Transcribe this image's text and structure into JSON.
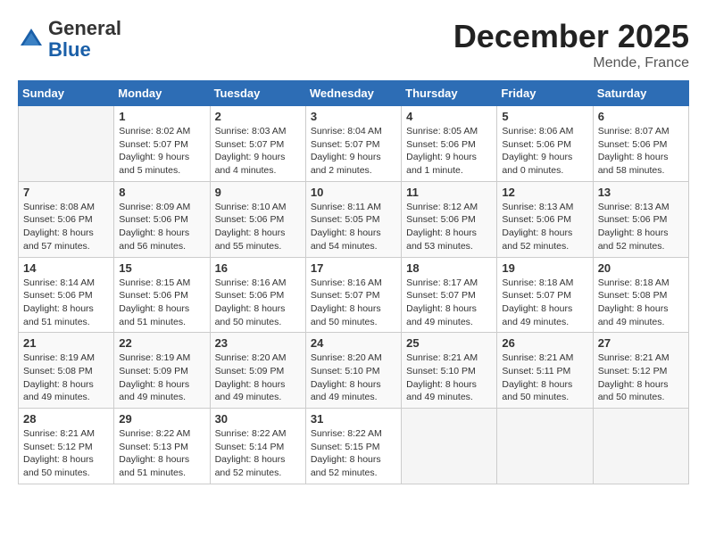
{
  "header": {
    "logo_general": "General",
    "logo_blue": "Blue",
    "month": "December 2025",
    "location": "Mende, France"
  },
  "days_of_week": [
    "Sunday",
    "Monday",
    "Tuesday",
    "Wednesday",
    "Thursday",
    "Friday",
    "Saturday"
  ],
  "weeks": [
    [
      {
        "day": "",
        "info": ""
      },
      {
        "day": "1",
        "info": "Sunrise: 8:02 AM\nSunset: 5:07 PM\nDaylight: 9 hours\nand 5 minutes."
      },
      {
        "day": "2",
        "info": "Sunrise: 8:03 AM\nSunset: 5:07 PM\nDaylight: 9 hours\nand 4 minutes."
      },
      {
        "day": "3",
        "info": "Sunrise: 8:04 AM\nSunset: 5:07 PM\nDaylight: 9 hours\nand 2 minutes."
      },
      {
        "day": "4",
        "info": "Sunrise: 8:05 AM\nSunset: 5:06 PM\nDaylight: 9 hours\nand 1 minute."
      },
      {
        "day": "5",
        "info": "Sunrise: 8:06 AM\nSunset: 5:06 PM\nDaylight: 9 hours\nand 0 minutes."
      },
      {
        "day": "6",
        "info": "Sunrise: 8:07 AM\nSunset: 5:06 PM\nDaylight: 8 hours\nand 58 minutes."
      }
    ],
    [
      {
        "day": "7",
        "info": "Sunrise: 8:08 AM\nSunset: 5:06 PM\nDaylight: 8 hours\nand 57 minutes."
      },
      {
        "day": "8",
        "info": "Sunrise: 8:09 AM\nSunset: 5:06 PM\nDaylight: 8 hours\nand 56 minutes."
      },
      {
        "day": "9",
        "info": "Sunrise: 8:10 AM\nSunset: 5:06 PM\nDaylight: 8 hours\nand 55 minutes."
      },
      {
        "day": "10",
        "info": "Sunrise: 8:11 AM\nSunset: 5:05 PM\nDaylight: 8 hours\nand 54 minutes."
      },
      {
        "day": "11",
        "info": "Sunrise: 8:12 AM\nSunset: 5:06 PM\nDaylight: 8 hours\nand 53 minutes."
      },
      {
        "day": "12",
        "info": "Sunrise: 8:13 AM\nSunset: 5:06 PM\nDaylight: 8 hours\nand 52 minutes."
      },
      {
        "day": "13",
        "info": "Sunrise: 8:13 AM\nSunset: 5:06 PM\nDaylight: 8 hours\nand 52 minutes."
      }
    ],
    [
      {
        "day": "14",
        "info": "Sunrise: 8:14 AM\nSunset: 5:06 PM\nDaylight: 8 hours\nand 51 minutes."
      },
      {
        "day": "15",
        "info": "Sunrise: 8:15 AM\nSunset: 5:06 PM\nDaylight: 8 hours\nand 51 minutes."
      },
      {
        "day": "16",
        "info": "Sunrise: 8:16 AM\nSunset: 5:06 PM\nDaylight: 8 hours\nand 50 minutes."
      },
      {
        "day": "17",
        "info": "Sunrise: 8:16 AM\nSunset: 5:07 PM\nDaylight: 8 hours\nand 50 minutes."
      },
      {
        "day": "18",
        "info": "Sunrise: 8:17 AM\nSunset: 5:07 PM\nDaylight: 8 hours\nand 49 minutes."
      },
      {
        "day": "19",
        "info": "Sunrise: 8:18 AM\nSunset: 5:07 PM\nDaylight: 8 hours\nand 49 minutes."
      },
      {
        "day": "20",
        "info": "Sunrise: 8:18 AM\nSunset: 5:08 PM\nDaylight: 8 hours\nand 49 minutes."
      }
    ],
    [
      {
        "day": "21",
        "info": "Sunrise: 8:19 AM\nSunset: 5:08 PM\nDaylight: 8 hours\nand 49 minutes."
      },
      {
        "day": "22",
        "info": "Sunrise: 8:19 AM\nSunset: 5:09 PM\nDaylight: 8 hours\nand 49 minutes."
      },
      {
        "day": "23",
        "info": "Sunrise: 8:20 AM\nSunset: 5:09 PM\nDaylight: 8 hours\nand 49 minutes."
      },
      {
        "day": "24",
        "info": "Sunrise: 8:20 AM\nSunset: 5:10 PM\nDaylight: 8 hours\nand 49 minutes."
      },
      {
        "day": "25",
        "info": "Sunrise: 8:21 AM\nSunset: 5:10 PM\nDaylight: 8 hours\nand 49 minutes."
      },
      {
        "day": "26",
        "info": "Sunrise: 8:21 AM\nSunset: 5:11 PM\nDaylight: 8 hours\nand 50 minutes."
      },
      {
        "day": "27",
        "info": "Sunrise: 8:21 AM\nSunset: 5:12 PM\nDaylight: 8 hours\nand 50 minutes."
      }
    ],
    [
      {
        "day": "28",
        "info": "Sunrise: 8:21 AM\nSunset: 5:12 PM\nDaylight: 8 hours\nand 50 minutes."
      },
      {
        "day": "29",
        "info": "Sunrise: 8:22 AM\nSunset: 5:13 PM\nDaylight: 8 hours\nand 51 minutes."
      },
      {
        "day": "30",
        "info": "Sunrise: 8:22 AM\nSunset: 5:14 PM\nDaylight: 8 hours\nand 52 minutes."
      },
      {
        "day": "31",
        "info": "Sunrise: 8:22 AM\nSunset: 5:15 PM\nDaylight: 8 hours\nand 52 minutes."
      },
      {
        "day": "",
        "info": ""
      },
      {
        "day": "",
        "info": ""
      },
      {
        "day": "",
        "info": ""
      }
    ]
  ]
}
